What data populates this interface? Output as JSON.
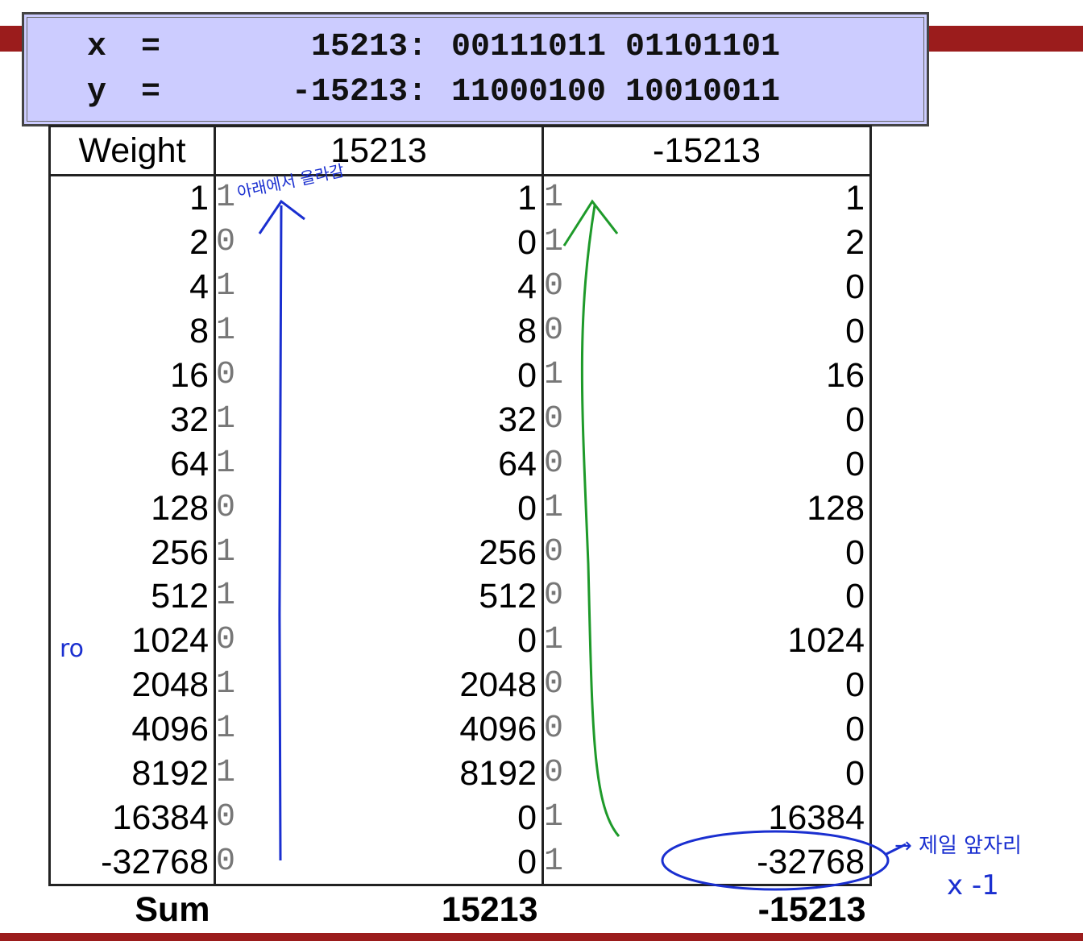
{
  "code_box": {
    "x_var": "x",
    "x_eq": "=",
    "x_dec": "15213:",
    "x_bin": "00111011 01101101",
    "y_var": "y",
    "y_eq": "=",
    "y_dec": "-15213:",
    "y_bin": "11000100 10010011"
  },
  "table": {
    "headers": [
      "Weight",
      "15213",
      "-15213"
    ],
    "rows": [
      {
        "w": "1",
        "xb": "1",
        "xv": "1",
        "yb": "1",
        "yv": "1"
      },
      {
        "w": "2",
        "xb": "0",
        "xv": "0",
        "yb": "1",
        "yv": "2"
      },
      {
        "w": "4",
        "xb": "1",
        "xv": "4",
        "yb": "0",
        "yv": "0"
      },
      {
        "w": "8",
        "xb": "1",
        "xv": "8",
        "yb": "0",
        "yv": "0"
      },
      {
        "w": "16",
        "xb": "0",
        "xv": "0",
        "yb": "1",
        "yv": "16"
      },
      {
        "w": "32",
        "xb": "1",
        "xv": "32",
        "yb": "0",
        "yv": "0"
      },
      {
        "w": "64",
        "xb": "1",
        "xv": "64",
        "yb": "0",
        "yv": "0"
      },
      {
        "w": "128",
        "xb": "0",
        "xv": "0",
        "yb": "1",
        "yv": "128"
      },
      {
        "w": "256",
        "xb": "1",
        "xv": "256",
        "yb": "0",
        "yv": "0"
      },
      {
        "w": "512",
        "xb": "1",
        "xv": "512",
        "yb": "0",
        "yv": "0"
      },
      {
        "w": "1024",
        "xb": "0",
        "xv": "0",
        "yb": "1",
        "yv": "1024"
      },
      {
        "w": "2048",
        "xb": "1",
        "xv": "2048",
        "yb": "0",
        "yv": "0"
      },
      {
        "w": "4096",
        "xb": "1",
        "xv": "4096",
        "yb": "0",
        "yv": "0"
      },
      {
        "w": "8192",
        "xb": "1",
        "xv": "8192",
        "yb": "0",
        "yv": "0"
      },
      {
        "w": "16384",
        "xb": "0",
        "xv": "0",
        "yb": "1",
        "yv": "16384"
      },
      {
        "w": "-32768",
        "xb": "0",
        "xv": "0",
        "yb": "1",
        "yv": "-32768"
      }
    ],
    "sum_label": "Sum",
    "sum_x": "15213",
    "sum_y": "-15213"
  },
  "annotations": {
    "blue_note_top": "아래에서 올라감",
    "blue_note_side": "ro",
    "blue_note_right": "→ 제일 앞자리",
    "blue_note_right2": "x -1",
    "blue_color": "#1a2fd0",
    "green_color": "#1e9a2a"
  }
}
